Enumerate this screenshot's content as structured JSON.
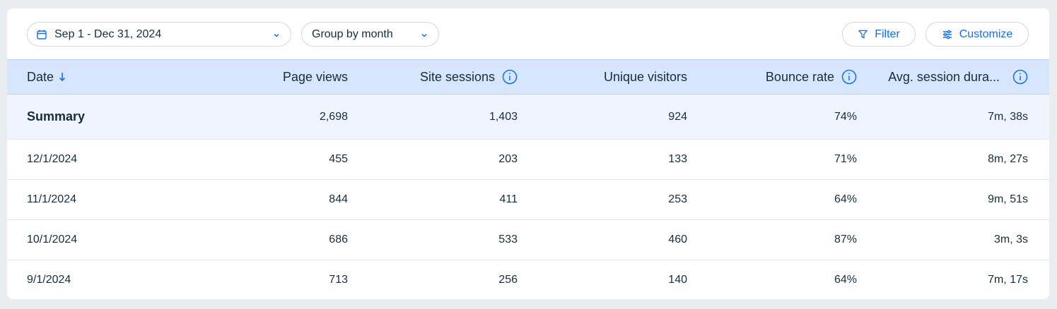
{
  "toolbar": {
    "date_range": "Sep 1 - Dec 31, 2024",
    "group_by": "Group by month",
    "filter_label": "Filter",
    "customize_label": "Customize"
  },
  "table": {
    "columns": [
      "Date",
      "Page views",
      "Site sessions",
      "Unique visitors",
      "Bounce rate",
      "Avg. session dura..."
    ],
    "summary": {
      "label": "Summary",
      "page_views": "2,698",
      "site_sessions": "1,403",
      "unique_visitors": "924",
      "bounce_rate": "74%",
      "avg_session": "7m, 38s"
    },
    "rows": [
      {
        "date": "12/1/2024",
        "page_views": "455",
        "site_sessions": "203",
        "unique_visitors": "133",
        "bounce_rate": "71%",
        "avg_session": "8m, 27s"
      },
      {
        "date": "11/1/2024",
        "page_views": "844",
        "site_sessions": "411",
        "unique_visitors": "253",
        "bounce_rate": "64%",
        "avg_session": "9m, 51s"
      },
      {
        "date": "10/1/2024",
        "page_views": "686",
        "site_sessions": "533",
        "unique_visitors": "460",
        "bounce_rate": "87%",
        "avg_session": "3m, 3s"
      },
      {
        "date": "9/1/2024",
        "page_views": "713",
        "site_sessions": "256",
        "unique_visitors": "140",
        "bounce_rate": "64%",
        "avg_session": "7m, 17s"
      }
    ]
  },
  "colors": {
    "accent": "#116dff",
    "header_bg": "#d7e6fd",
    "summary_bg": "#eff4fe",
    "text": "#162d3d"
  },
  "icons": {
    "calendar": "calendar-icon",
    "chevron": "chevron-down-icon",
    "filter": "filter-icon",
    "customize": "sliders-icon",
    "sort": "sort-arrow-down-icon",
    "info": "info-icon"
  }
}
